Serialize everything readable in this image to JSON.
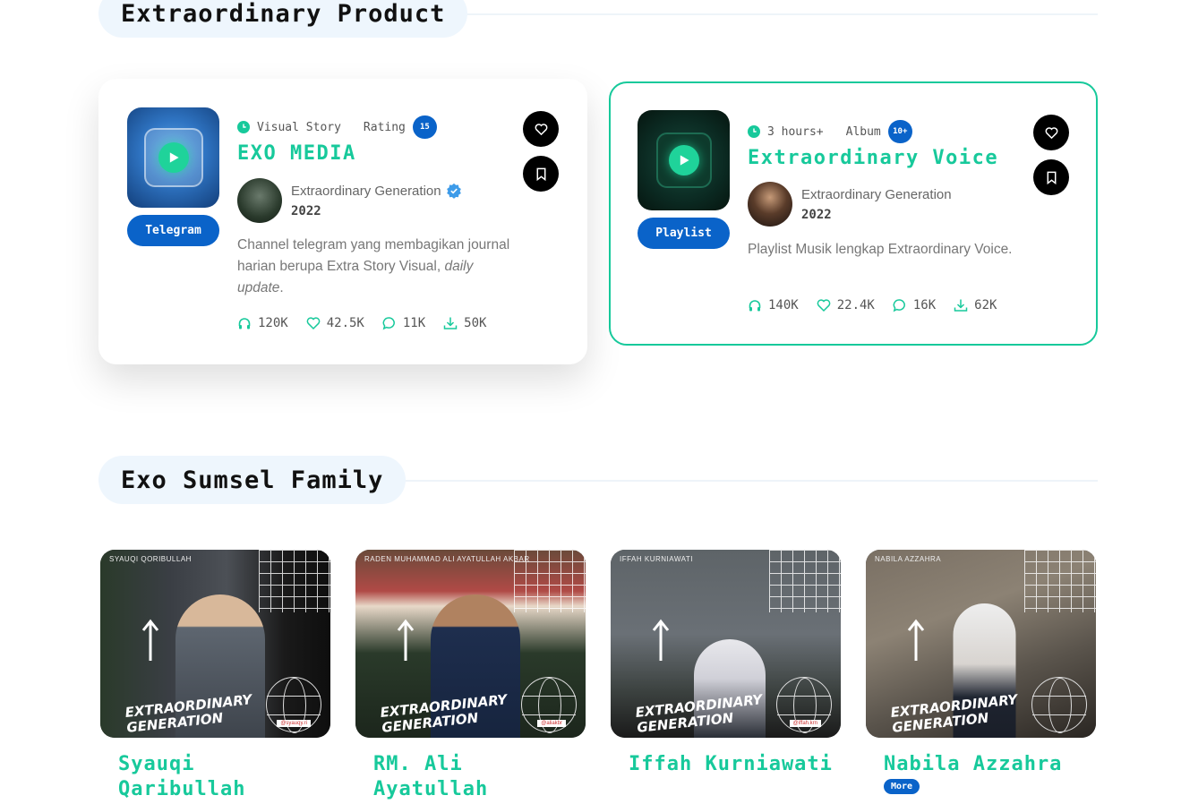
{
  "sections": {
    "products_title": "Extraordinary Product",
    "family_title": "Exo Sumsel Family"
  },
  "products": [
    {
      "tag": "Telegram",
      "meta_type": "Visual Story",
      "meta_label": "Rating",
      "meta_badge": "15",
      "title": "EXO MEDIA",
      "author": "Extraordinary Generation",
      "verified": true,
      "year": "2022",
      "description_main": "Channel telegram yang membagikan journal harian berupa Extra Story Visual, ",
      "description_em": "daily update",
      "description_end": ".",
      "stats": {
        "listens": "120K",
        "likes": "42.5K",
        "comments": "11K",
        "downloads": "50K"
      },
      "thumb_color": "#2f74c2"
    },
    {
      "tag": "Playlist",
      "meta_type": "3 hours+",
      "meta_label": "Album",
      "meta_badge": "10+",
      "title": "Extraordinary Voice",
      "author": "Extraordinary Generation",
      "verified": false,
      "year": "2022",
      "description_main": "Playlist Musik lengkap Extraordinary Voice.",
      "stats": {
        "listens": "140K",
        "likes": "22.4K",
        "comments": "16K",
        "downloads": "62K"
      },
      "thumb_color": "#0b2a22"
    }
  ],
  "members": [
    {
      "name": "Syauqi Qaribullah",
      "caption": "SYAUQI QORIBULLAH",
      "handle": "@syauqy.ri"
    },
    {
      "name": "RM. Ali Ayatullah",
      "caption": "RADEN MUHAMMAD ALI AYATULLAH AKBAR",
      "handle": "@aliakbr"
    },
    {
      "name": "Iffah Kurniawati",
      "caption": "IFFAH KURNIAWATI",
      "handle": "@iffah.krn"
    },
    {
      "name": "Nabila Azzahra",
      "caption": "NABILA AZZAHRA",
      "handle": ""
    }
  ],
  "member_poster_text": "EXTRAORDINARY GENERATION",
  "more_label": "More",
  "colors": {
    "accent_green": "#17c99b",
    "brand_blue": "#0a63c9"
  },
  "icons": {
    "clock": "clock-icon",
    "headphones": "headphones-icon",
    "heart": "heart-icon",
    "comment": "comment-icon",
    "download": "download-icon",
    "bookmark": "bookmark-icon",
    "play": "play-icon",
    "verified": "verified-badge-icon"
  }
}
